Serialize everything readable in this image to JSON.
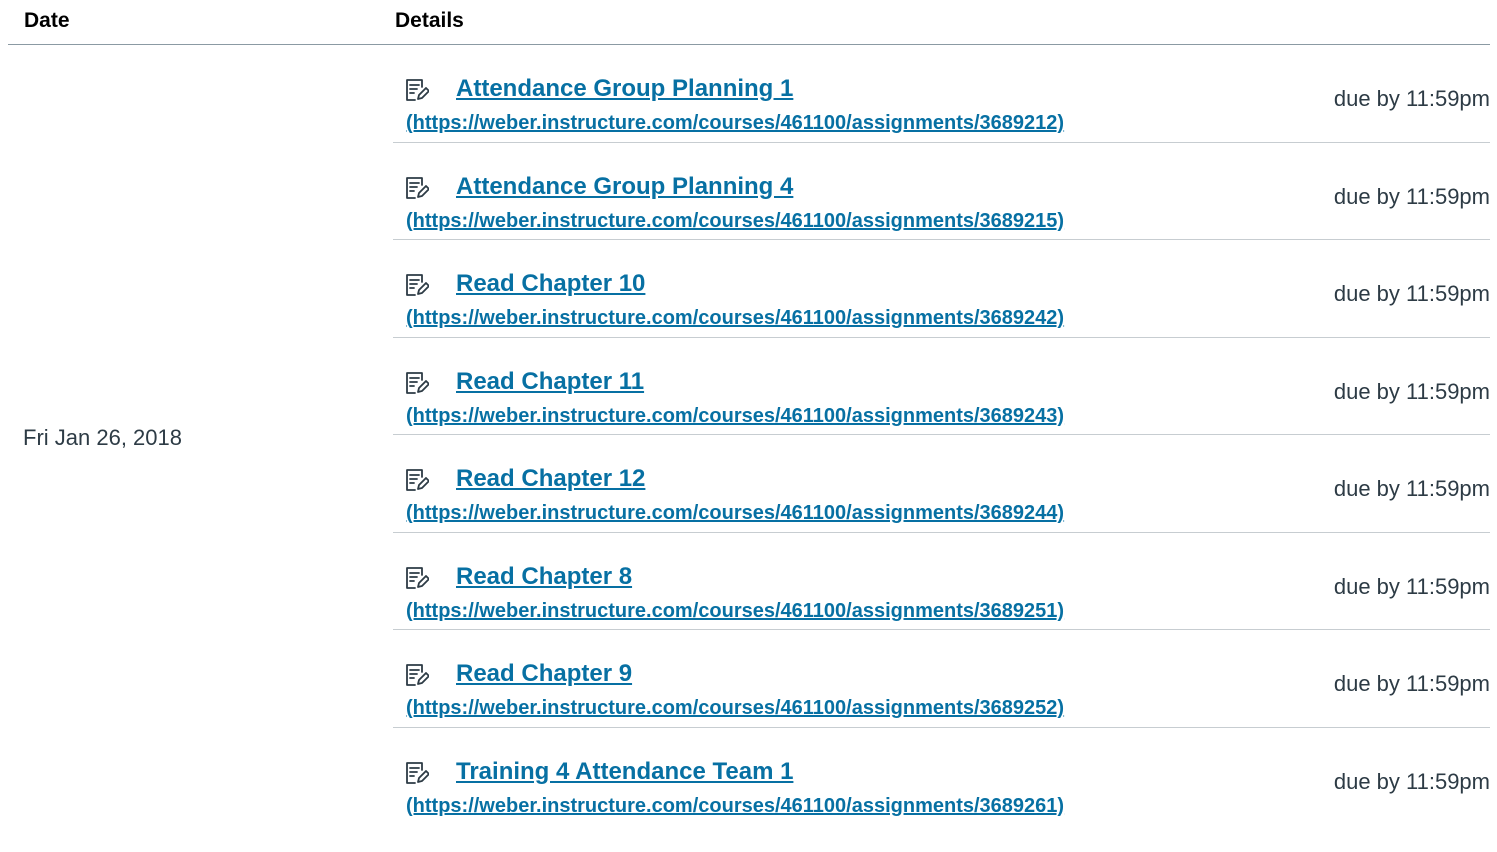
{
  "table": {
    "headers": {
      "date": "Date",
      "details": "Details"
    },
    "date": "Fri Jan 26, 2018",
    "items": [
      {
        "icon": "assignment-icon",
        "title": "Attendance Group Planning 1",
        "url": "(https://weber.instructure.com/courses/461100/assignments/3689212)",
        "due": "due by 11:59pm"
      },
      {
        "icon": "assignment-icon",
        "title": "Attendance Group Planning 4",
        "url": "(https://weber.instructure.com/courses/461100/assignments/3689215)",
        "due": "due by 11:59pm"
      },
      {
        "icon": "assignment-icon",
        "title": "Read Chapter 10",
        "url": "(https://weber.instructure.com/courses/461100/assignments/3689242)",
        "due": "due by 11:59pm"
      },
      {
        "icon": "assignment-icon",
        "title": "Read Chapter 11",
        "url": "(https://weber.instructure.com/courses/461100/assignments/3689243)",
        "due": "due by 11:59pm"
      },
      {
        "icon": "assignment-icon",
        "title": "Read Chapter 12",
        "url": "(https://weber.instructure.com/courses/461100/assignments/3689244)",
        "due": "due by 11:59pm"
      },
      {
        "icon": "assignment-icon",
        "title": "Read Chapter 8",
        "url": "(https://weber.instructure.com/courses/461100/assignments/3689251)",
        "due": "due by 11:59pm"
      },
      {
        "icon": "assignment-icon",
        "title": "Read Chapter 9",
        "url": "(https://weber.instructure.com/courses/461100/assignments/3689252)",
        "due": "due by 11:59pm"
      },
      {
        "icon": "assignment-icon",
        "title": "Training 4 Attendance Team 1",
        "url": "(https://weber.instructure.com/courses/461100/assignments/3689261)",
        "due": "due by 11:59pm"
      }
    ]
  },
  "colors": {
    "link": "#0770a3",
    "text": "#2d3b45",
    "header_rule": "#8b9aa3",
    "row_rule": "#c7cdd1"
  }
}
